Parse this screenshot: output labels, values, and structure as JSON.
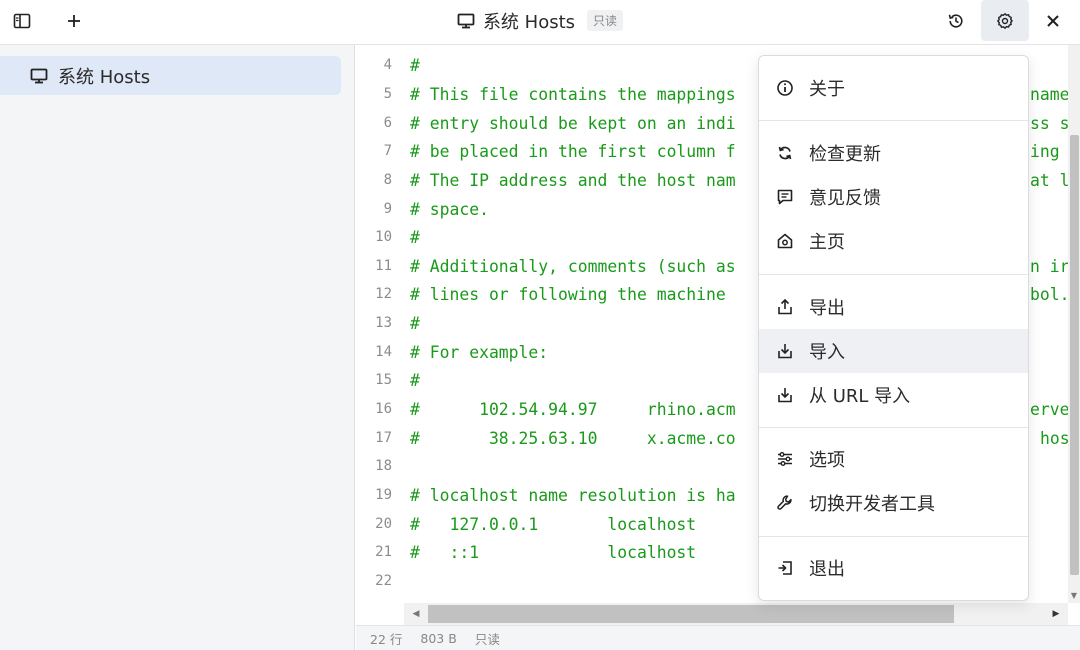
{
  "window": {
    "title": "系统 Hosts",
    "readonly_badge": "只读"
  },
  "sidebar": {
    "items": [
      {
        "label": "系统 Hosts",
        "icon": "monitor-icon",
        "selected": true
      }
    ]
  },
  "editor": {
    "lines": [
      {
        "num": "4",
        "text": "#"
      },
      {
        "num": "5",
        "text": "# This file contains the mappings"
      },
      {
        "num": "6",
        "text": "# entry should be kept on an indi"
      },
      {
        "num": "7",
        "text": "# be placed in the first column f"
      },
      {
        "num": "8",
        "text": "# The IP address and the host nam"
      },
      {
        "num": "9",
        "text": "# space."
      },
      {
        "num": "10",
        "text": "#"
      },
      {
        "num": "11",
        "text": "# Additionally, comments (such as"
      },
      {
        "num": "12",
        "text": "# lines or following the machine"
      },
      {
        "num": "13",
        "text": "#"
      },
      {
        "num": "14",
        "text": "# For example:"
      },
      {
        "num": "15",
        "text": "#"
      },
      {
        "num": "16",
        "text": "#      102.54.94.97     rhino.acm"
      },
      {
        "num": "17",
        "text": "#       38.25.63.10     x.acme.co"
      },
      {
        "num": "18",
        "text": ""
      },
      {
        "num": "19",
        "text": "# localhost name resolution is ha"
      },
      {
        "num": "20",
        "text": "#   127.0.0.1       localhost"
      },
      {
        "num": "21",
        "text": "#   ::1             localhost"
      },
      {
        "num": "22",
        "text": ""
      }
    ],
    "right_fragments": [
      {
        "num": "5",
        "text": "name"
      },
      {
        "num": "6",
        "text": "ss s"
      },
      {
        "num": "7",
        "text": "ing"
      },
      {
        "num": "8",
        "text": "at l"
      },
      {
        "num": "11",
        "text": "n ir"
      },
      {
        "num": "12",
        "text": "bol."
      },
      {
        "num": "16",
        "text": "erve"
      },
      {
        "num": "17",
        "text": "hos"
      }
    ]
  },
  "status": {
    "lines": "22 行",
    "size": "803 B",
    "mode": "只读"
  },
  "menu": {
    "items": [
      {
        "label": "关于",
        "icon": "info-icon"
      },
      {
        "label": "检查更新",
        "icon": "refresh-icon"
      },
      {
        "label": "意见反馈",
        "icon": "feedback-icon"
      },
      {
        "label": "主页",
        "icon": "home-icon"
      },
      {
        "label": "导出",
        "icon": "export-icon"
      },
      {
        "label": "导入",
        "icon": "import-icon",
        "highlighted": true
      },
      {
        "label": "从 URL 导入",
        "icon": "import-url-icon"
      },
      {
        "label": "选项",
        "icon": "sliders-icon"
      },
      {
        "label": "切换开发者工具",
        "icon": "wrench-icon"
      },
      {
        "label": "退出",
        "icon": "exit-icon"
      }
    ]
  },
  "colors": {
    "code_comment": "#1a9a1a",
    "selected_bg": "#dfe8f6",
    "menu_highlight": "#eef0f3"
  }
}
